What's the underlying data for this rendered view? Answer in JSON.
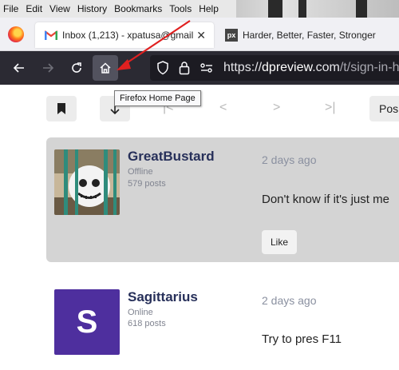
{
  "menubar": {
    "items": [
      "File",
      "Edit",
      "View",
      "History",
      "Bookmarks",
      "Tools",
      "Help"
    ]
  },
  "tabs": [
    {
      "icon": "gmail-icon",
      "label": "Inbox (1,213) - xpatusa@gmail",
      "active": true
    },
    {
      "icon": "px-icon",
      "icon_text": "px",
      "label": "Harder, Better, Faster, Stronger",
      "active": false
    }
  ],
  "nav": {
    "url_scheme": "https://",
    "url_host": "dpreview",
    "url_host_suffix": ".com",
    "url_path": "/t/sign-in-has-c",
    "tooltip": "Firefox Home Page"
  },
  "toolbar": {
    "pager_first": "|<",
    "pager_prev": "<",
    "pager_next": ">",
    "pager_last": ">|",
    "post_label": "Pos"
  },
  "posts": [
    {
      "username": "GreatBustard",
      "status": "Offline",
      "post_count": "579 posts",
      "date": "2 days ago",
      "text": "Don't know if it's just me",
      "like_label": "Like"
    },
    {
      "username": "Sagittarius",
      "status": "Online",
      "post_count": "618 posts",
      "date": "2 days ago",
      "text": "Try to pres F11",
      "avatar_letter": "S"
    }
  ],
  "colors": {
    "accent_nav": "#2b2a33",
    "post_bg": "#d4d4d4",
    "username": "#27305a",
    "avatar_purple": "#4e2f9e",
    "annotation_arrow": "#e02020"
  }
}
